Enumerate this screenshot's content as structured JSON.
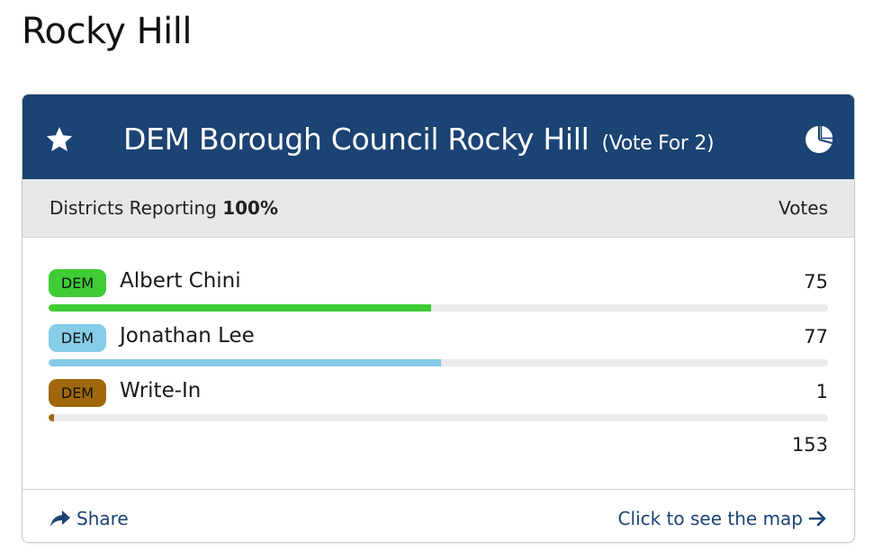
{
  "page": {
    "title": "Rocky Hill"
  },
  "race": {
    "title": "DEM Borough Council Rocky Hill",
    "vote_for": "(Vote For 2)",
    "header_color": "#1b4373",
    "icons": {
      "favorite": "star-icon",
      "results_chart": "pie-chart-icon"
    }
  },
  "reporting": {
    "label": "Districts Reporting",
    "percent": "100%",
    "votes_header": "Votes"
  },
  "candidates": [
    {
      "party": "DEM",
      "name": "Albert Chini",
      "votes": "75",
      "color": "#3fcc34",
      "share": 0.491
    },
    {
      "party": "DEM",
      "name": "Jonathan Lee",
      "votes": "77",
      "color": "#86cce8",
      "share": 0.503
    },
    {
      "party": "DEM",
      "name": "Write-In",
      "votes": "1",
      "color": "#a0680b",
      "share": 0.0065
    }
  ],
  "total_votes": "153",
  "footer": {
    "share_label": "Share",
    "share_icon": "share-arrow-icon",
    "map_label": "Click to see the map",
    "map_icon": "arrow-right-icon",
    "link_color": "#1b4373"
  }
}
